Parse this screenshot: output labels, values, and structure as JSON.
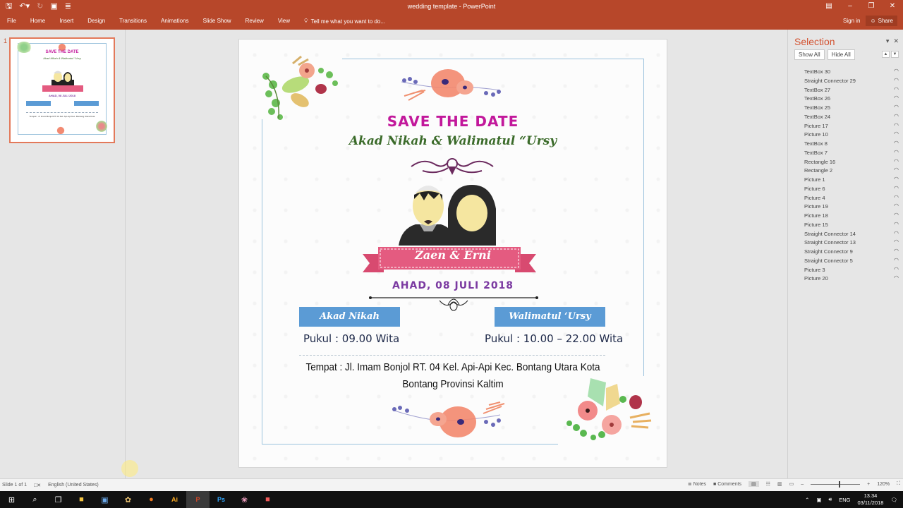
{
  "window": {
    "title": "wedding template - PowerPoint",
    "controls": [
      "ribbon-display-options",
      "minimize",
      "restore",
      "close"
    ]
  },
  "quick_access": {
    "save_icon": "save-icon",
    "undo_icon": "undo-icon",
    "redo_icon": "redo-icon",
    "present_icon": "start-from-beginning-icon",
    "customize_icon": "customize-qat-icon"
  },
  "ribbon": {
    "tabs": [
      "File",
      "Home",
      "Insert",
      "Design",
      "Transitions",
      "Animations",
      "Slide Show",
      "Review",
      "View"
    ],
    "tell_me": "Tell me what you want to do...",
    "sign_in": "Sign in",
    "share": "Share"
  },
  "thumbnails": [
    {
      "number": "1",
      "selected": true
    }
  ],
  "slide": {
    "title": "SAVE THE DATE",
    "subtitle": "Akad Nikah & Walimatul “Ursy",
    "names": "Zaen & Erni",
    "date": "AHAD, 08 JULI 2018",
    "events": [
      {
        "label": "Akad Nikah",
        "time": "Pukul : 09.00 Wita"
      },
      {
        "label": "Walimatul ‘Ursy",
        "time": "Pukul : 10.00 – 22.00 Wita"
      }
    ],
    "venue_line1": "Tempat : Jl. Imam Bonjol RT. 04 Kel. Api-Api Kec. Bontang Utara Kota",
    "venue_line2": "Bontang Provinsi Kaltim",
    "colors": {
      "title": "#c2189b",
      "subtitle": "#3b6b2a",
      "ribbon": "#e45b80",
      "date": "#7b3aa1",
      "event_box": "#5b9bd5",
      "frame": "#9cc3dd"
    }
  },
  "selection_pane": {
    "title": "Selection",
    "show_all": "Show All",
    "hide_all": "Hide All",
    "items": [
      "TextBox 30",
      "Straight Connector 29",
      "TextBox 27",
      "TextBox 26",
      "TextBox 25",
      "TextBox 24",
      "Picture 17",
      "Picture 10",
      "TextBox 8",
      "TextBox 7",
      "Rectangle 16",
      "Rectangle 2",
      "Picture 1",
      "Picture 6",
      "Picture 4",
      "Picture 19",
      "Picture 18",
      "Picture 15",
      "Straight Connector 14",
      "Straight Connector 13",
      "Straight Connector 9",
      "Straight Connector 5",
      "Picture 3",
      "Picture 20"
    ]
  },
  "status_bar": {
    "slide_info": "Slide 1 of 1",
    "language": "English (United States)",
    "notes": "Notes",
    "comments": "Comments",
    "zoom": "120%"
  },
  "taskbar": {
    "apps": [
      "start",
      "search",
      "task-view",
      "file-explorer",
      "network-app",
      "paint-app",
      "firefox",
      "illustrator",
      "powerpoint",
      "photoshop",
      "chrome-like",
      "photo-app"
    ],
    "active_app": "powerpoint",
    "language": "ENG",
    "time": "13.34",
    "date": "03/11/2018"
  }
}
